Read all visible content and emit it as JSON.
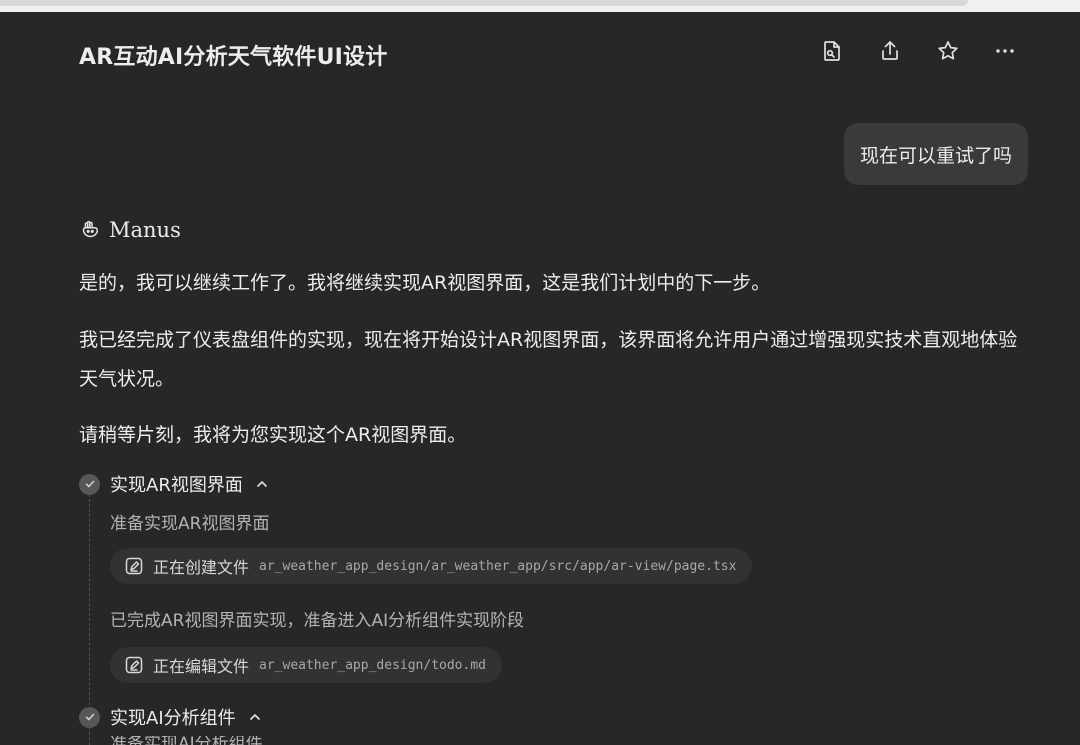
{
  "header": {
    "title": "AR互动AI分析天气软件UI设计",
    "icons": [
      "document-icon",
      "share-icon",
      "star-icon",
      "more-icon"
    ]
  },
  "user_message": {
    "text": "现在可以重试了吗"
  },
  "assistant": {
    "name": "Manus",
    "paragraphs": [
      "是的，我可以继续工作了。我将继续实现AR视图界面，这是我们计划中的下一步。",
      "我已经完成了仪表盘组件的实现，现在将开始设计AR视图界面，该界面将允许用户通过增强现实技术直观地体验天气状况。",
      "请稍等片刻，我将为您实现这个AR视图界面。"
    ]
  },
  "steps": [
    {
      "title": "实现AR视图界面",
      "status_1": "准备实现AR视图界面",
      "chip_1": {
        "label": "正在创建文件",
        "path": "ar_weather_app_design/ar_weather_app/src/app/ar-view/page.tsx"
      },
      "status_2": "已完成AR视图界面实现，准备进入AI分析组件实现阶段",
      "chip_2": {
        "label": "正在编辑文件",
        "path": "ar_weather_app_design/todo.md"
      }
    },
    {
      "title": "实现AI分析组件",
      "status_1": "准备实现AI分析组件"
    }
  ],
  "colors": {
    "background": "#272727",
    "bubble": "#3a3a3a",
    "chip": "#323232",
    "check": "#575757"
  }
}
